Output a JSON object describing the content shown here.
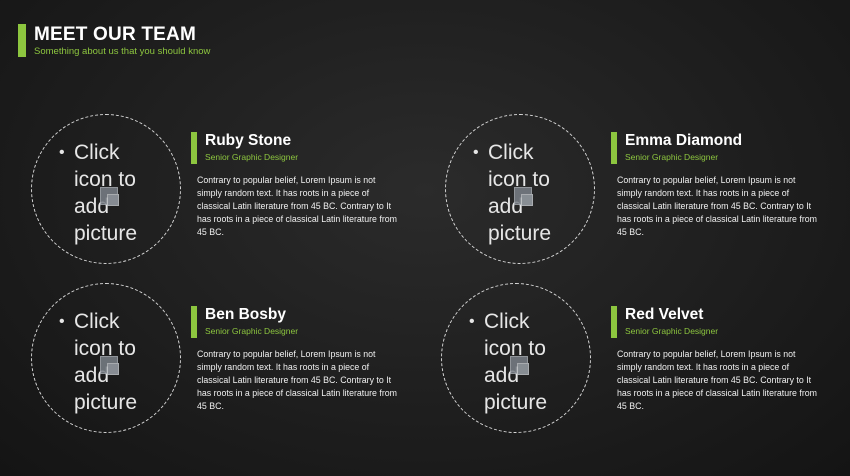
{
  "header": {
    "title": "MEET OUR TEAM",
    "subtitle": "Something about us that you should know"
  },
  "placeholder": {
    "line1": "Click",
    "line2": "icon to",
    "line3": "add",
    "line4": "picture",
    "bullet": "•"
  },
  "members": [
    {
      "name": "Ruby Stone",
      "role": "Senior Graphic Designer",
      "description": "Contrary to popular belief, Lorem Ipsum is not simply random text. It has roots in a piece of classical Latin literature from 45 BC. Contrary to It has roots in a piece of classical Latin literature from 45 BC."
    },
    {
      "name": "Emma Diamond",
      "role": "Senior Graphic Designer",
      "description": "Contrary to popular belief, Lorem Ipsum is not simply random text. It has roots in a piece of classical Latin literature from 45 BC. Contrary to It has roots in a piece of classical Latin literature from 45 BC."
    },
    {
      "name": "Ben Bosby",
      "role": "Senior Graphic Designer",
      "description": "Contrary to popular belief, Lorem Ipsum is not simply random text. It has roots in a piece of classical Latin literature from 45 BC. Contrary to It has roots in a piece of classical Latin literature from 45 BC."
    },
    {
      "name": "Red Velvet",
      "role": "Senior Graphic Designer",
      "description": "Contrary to popular belief, Lorem Ipsum is not simply random text. It has roots in a piece of classical Latin literature from 45 BC. Contrary to It has roots in a piece of classical Latin literature from 45 BC."
    }
  ],
  "colors": {
    "accent": "#8dc63f",
    "background": "#1d1d1d",
    "text": "#ffffff"
  }
}
